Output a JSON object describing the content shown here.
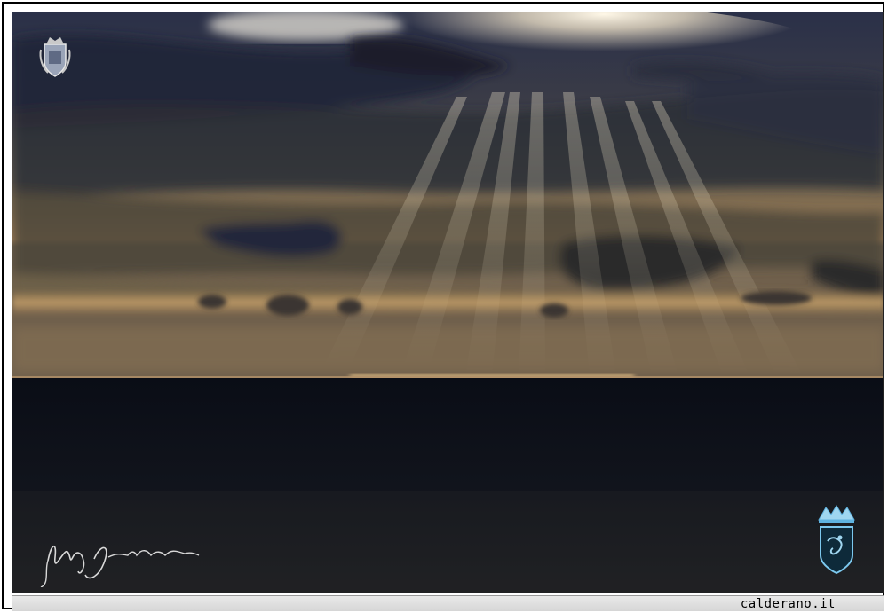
{
  "photo": {
    "subject": "sunset-over-sea",
    "colors": {
      "sky_dark": "#1c2233",
      "cloud_mid": "#5a5448",
      "glow": "#e6b877",
      "horizon": "#c99a5a",
      "sea": "#0b0f19"
    }
  },
  "watermarks": {
    "top_left": "coat-of-arms-icon",
    "bottom_right": "crowned-shield-icon",
    "signature": "handwritten-signature"
  },
  "caption": {
    "site": "calderano.it"
  }
}
